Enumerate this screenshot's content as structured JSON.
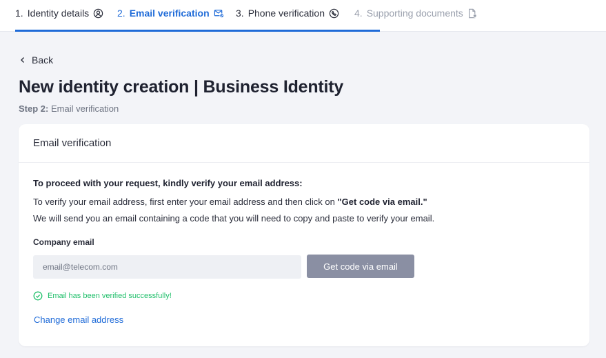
{
  "stepper": {
    "steps": [
      {
        "number": "1.",
        "label": "Identity details",
        "icon": "user-circle-icon",
        "state": "done"
      },
      {
        "number": "2.",
        "label": "Email verification",
        "icon": "mail-check-icon",
        "state": "active"
      },
      {
        "number": "3.",
        "label": "Phone verification",
        "icon": "phone-icon",
        "state": "pending-dark"
      },
      {
        "number": "4.",
        "label": "Supporting documents",
        "icon": "document-icon",
        "state": "pending"
      }
    ]
  },
  "header": {
    "back_label": "Back",
    "title": "New identity creation | Business Identity",
    "step_prefix": "Step 2:",
    "step_label": "Email verification"
  },
  "card": {
    "title": "Email verification",
    "intro_bold": "To proceed with your request, kindly verify your email address:",
    "intro_line1_prefix": "To verify your email address, first enter your email address and then click on",
    "intro_line1_bold": "\"Get code via email.\"",
    "intro_line2": "We will send you an email containing a code that you will need to copy and paste to verify your email.",
    "field_label": "Company email",
    "email_value": "email@telecom.com",
    "get_code_label": "Get code via email",
    "success_message": "Email has been verified successfully!",
    "change_email_label": "Change email address"
  },
  "colors": {
    "accent": "#1f6bd8",
    "success": "#1fbf6a",
    "disabled_button": "#8a8fa3",
    "background": "#f3f4f8"
  }
}
